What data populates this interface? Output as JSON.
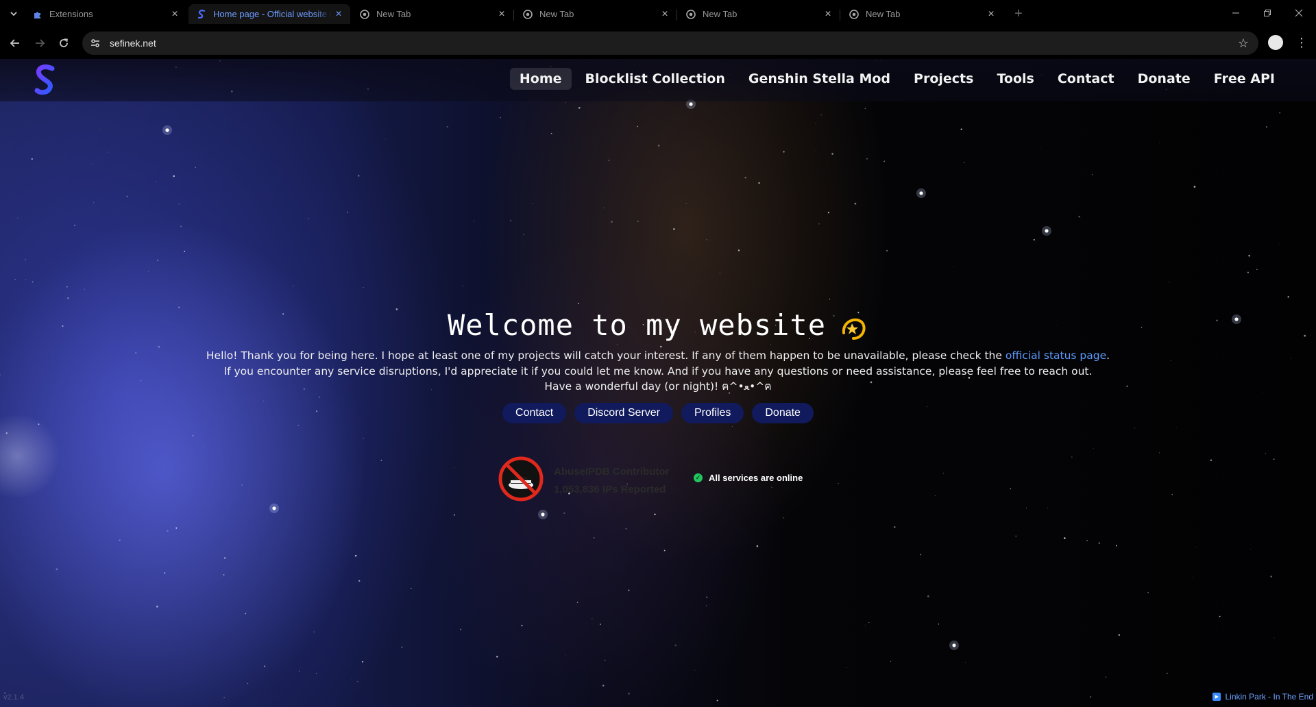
{
  "browser": {
    "tabs": [
      {
        "label": "Extensions",
        "icon": "puzzle-icon"
      },
      {
        "label": "Home page - Official website of Sefinek",
        "icon": "sefinek-favicon",
        "active": true
      },
      {
        "label": "New Tab",
        "icon": "chrome-icon"
      },
      {
        "label": "New Tab",
        "icon": "chrome-icon"
      },
      {
        "label": "New Tab",
        "icon": "chrome-icon"
      },
      {
        "label": "New Tab",
        "icon": "chrome-icon"
      }
    ],
    "url": "sefinek.net"
  },
  "site": {
    "nav": [
      "Home",
      "Blocklist Collection",
      "Genshin Stella Mod",
      "Projects",
      "Tools",
      "Contact",
      "Donate",
      "Free API"
    ],
    "hero": {
      "title": "Welcome to my website",
      "line1_before": "Hello! Thank you for being here. I hope at least one of my projects will catch your interest. If any of them happen to be unavailable, please check the ",
      "line1_link": "official status page",
      "line1_after": ".",
      "line2": "If you encounter any service disruptions, I'd appreciate it if you could let me know. And if you have any questions or need assistance, please feel free to reach out.",
      "line3": "Have a wonderful day (or night)! ฅ^•ﻌ•^ฅ"
    },
    "buttons": [
      "Contact",
      "Discord Server",
      "Profiles",
      "Donate"
    ],
    "abuseipdb": {
      "title": "AbuseIPDB Contributor",
      "reported": "1,053,836 IPs Reported"
    },
    "status": "All services are online",
    "version": "v2.1.4",
    "now_playing": "Linkin Park - In The End"
  },
  "colors": {
    "accent_link": "#5e9bff",
    "pill_bg": "#101a5c",
    "status_ok": "#22c55e",
    "active_tab_text": "#6f9bff"
  }
}
